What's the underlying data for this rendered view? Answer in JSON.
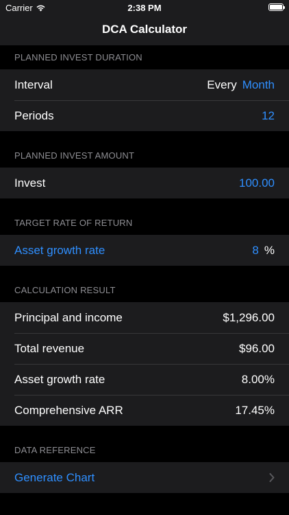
{
  "status_bar": {
    "carrier": "Carrier",
    "time": "2:38 PM",
    "icons": [
      "wifi-icon",
      "battery-icon"
    ]
  },
  "nav": {
    "title": "DCA Calculator"
  },
  "sections": {
    "duration": {
      "header": "PLANNED INVEST DURATION",
      "interval_label": "Interval",
      "interval_prefix": "Every",
      "interval_value": "Month",
      "periods_label": "Periods",
      "periods_value": "12"
    },
    "amount": {
      "header": "PLANNED INVEST AMOUNT",
      "invest_label": "Invest",
      "invest_value": "100.00"
    },
    "rate": {
      "header": "TARGET RATE OF RETURN",
      "growth_label": "Asset growth rate",
      "growth_value": "8",
      "growth_unit": "%"
    },
    "result": {
      "header": "CALCULATION RESULT",
      "rows": [
        {
          "label": "Principal and income",
          "value": "$1,296.00"
        },
        {
          "label": "Total revenue",
          "value": "$96.00"
        },
        {
          "label": "Asset growth rate",
          "value": "8.00%"
        },
        {
          "label": "Comprehensive ARR",
          "value": "17.45%"
        }
      ]
    },
    "reference": {
      "header": "DATA REFERENCE",
      "generate_label": "Generate Chart"
    }
  },
  "colors": {
    "accent": "#2f8fff",
    "background": "#000000",
    "cell": "#1c1c1e",
    "header_text": "#8e8e93"
  }
}
